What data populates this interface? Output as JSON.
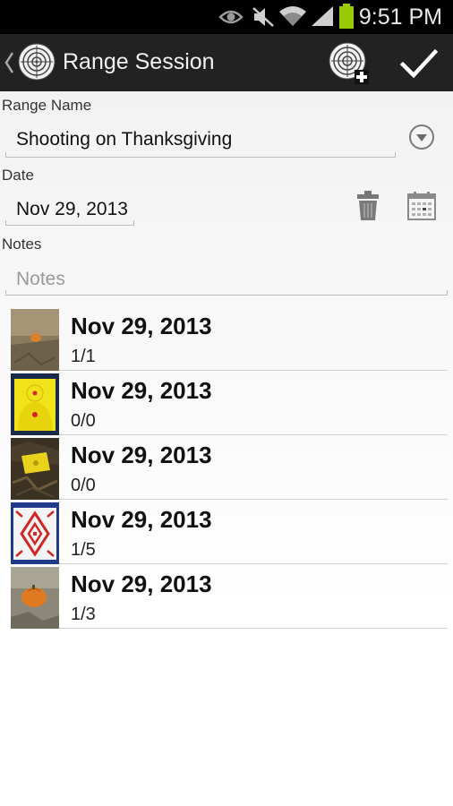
{
  "status_bar": {
    "time": "9:51 PM",
    "icons": [
      "eye-icon",
      "mute-icon",
      "wifi-icon",
      "signal-icon",
      "battery-icon"
    ]
  },
  "action_bar": {
    "title": "Range Session",
    "icons": [
      "up-caret-icon",
      "target-app-icon",
      "add-target-icon",
      "checkmark-icon"
    ]
  },
  "form": {
    "range_name_label": "Range Name",
    "range_name_value": "Shooting on Thanksgiving",
    "date_label": "Date",
    "date_value": "Nov 29, 2013",
    "notes_label": "Notes",
    "notes_placeholder": "Notes"
  },
  "sessions": [
    {
      "date": "Nov 29, 2013",
      "score": "1/1",
      "thumb": "pumpkin-small"
    },
    {
      "date": "Nov 29, 2013",
      "score": "0/0",
      "thumb": "yellow-silhouette-target"
    },
    {
      "date": "Nov 29, 2013",
      "score": "0/0",
      "thumb": "yellow-target-on-ground"
    },
    {
      "date": "Nov 29, 2013",
      "score": "1/5",
      "thumb": "red-diamond-target"
    },
    {
      "date": "Nov 29, 2013",
      "score": "1/3",
      "thumb": "pumpkin-on-ground"
    }
  ],
  "colors": {
    "status_bar": "#000000",
    "action_bar": "#222222",
    "battery": "#99cc00"
  }
}
